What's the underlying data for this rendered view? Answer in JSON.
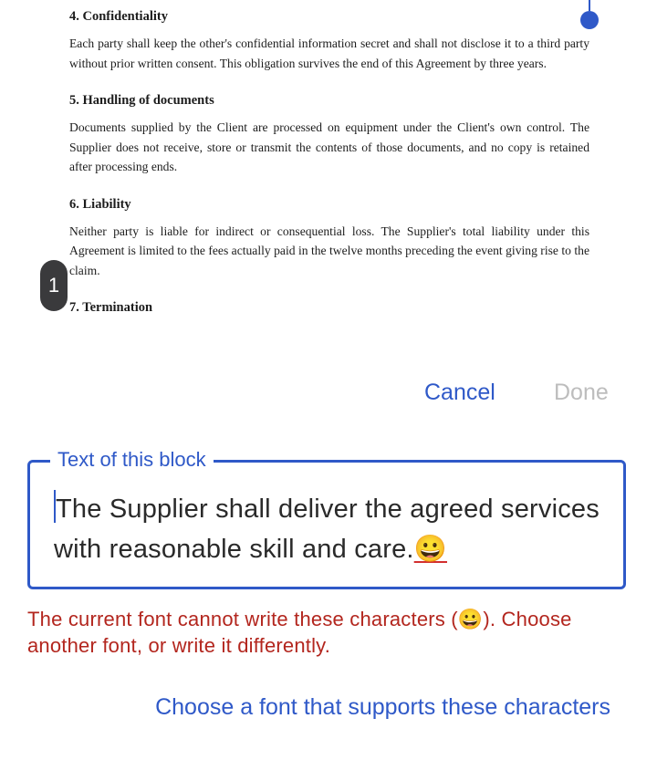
{
  "document": {
    "sections": [
      {
        "heading": "4. Confidentiality",
        "body": "Each party shall keep the other's confidential information secret and shall not disclose it to a third party without prior written consent. This obligation survives the end of this Agreement by three years."
      },
      {
        "heading": "5. Handling of documents",
        "body": "Documents supplied by the Client are processed on equipment under the Client's own control. The Supplier does not receive, store or transmit the contents of those documents, and no copy is retained after processing ends."
      },
      {
        "heading": "6. Liability",
        "body": "Neither party is liable for indirect or consequential loss. The Supplier's total liability under this Agreement is limited to the fees actually paid in the twelve months preceding the event giving rise to the claim."
      },
      {
        "heading": "7. Termination",
        "body": ""
      }
    ],
    "page_badge": "1"
  },
  "actions": {
    "cancel_label": "Cancel",
    "done_label": "Done"
  },
  "editor": {
    "label": "Text of this block",
    "text": "The Supplier shall deliver the agreed services with reasonable skill and care.",
    "unsupported_char": "😀"
  },
  "error": {
    "message": "The current font cannot write these characters (😀). Choose another font, or write it differently."
  },
  "link": {
    "label": "Choose a font that supports these characters"
  },
  "colors": {
    "accent": "#2f59c8",
    "error": "#b3261e",
    "disabled": "#bdbdbd",
    "badge": "#3a3a3c"
  }
}
